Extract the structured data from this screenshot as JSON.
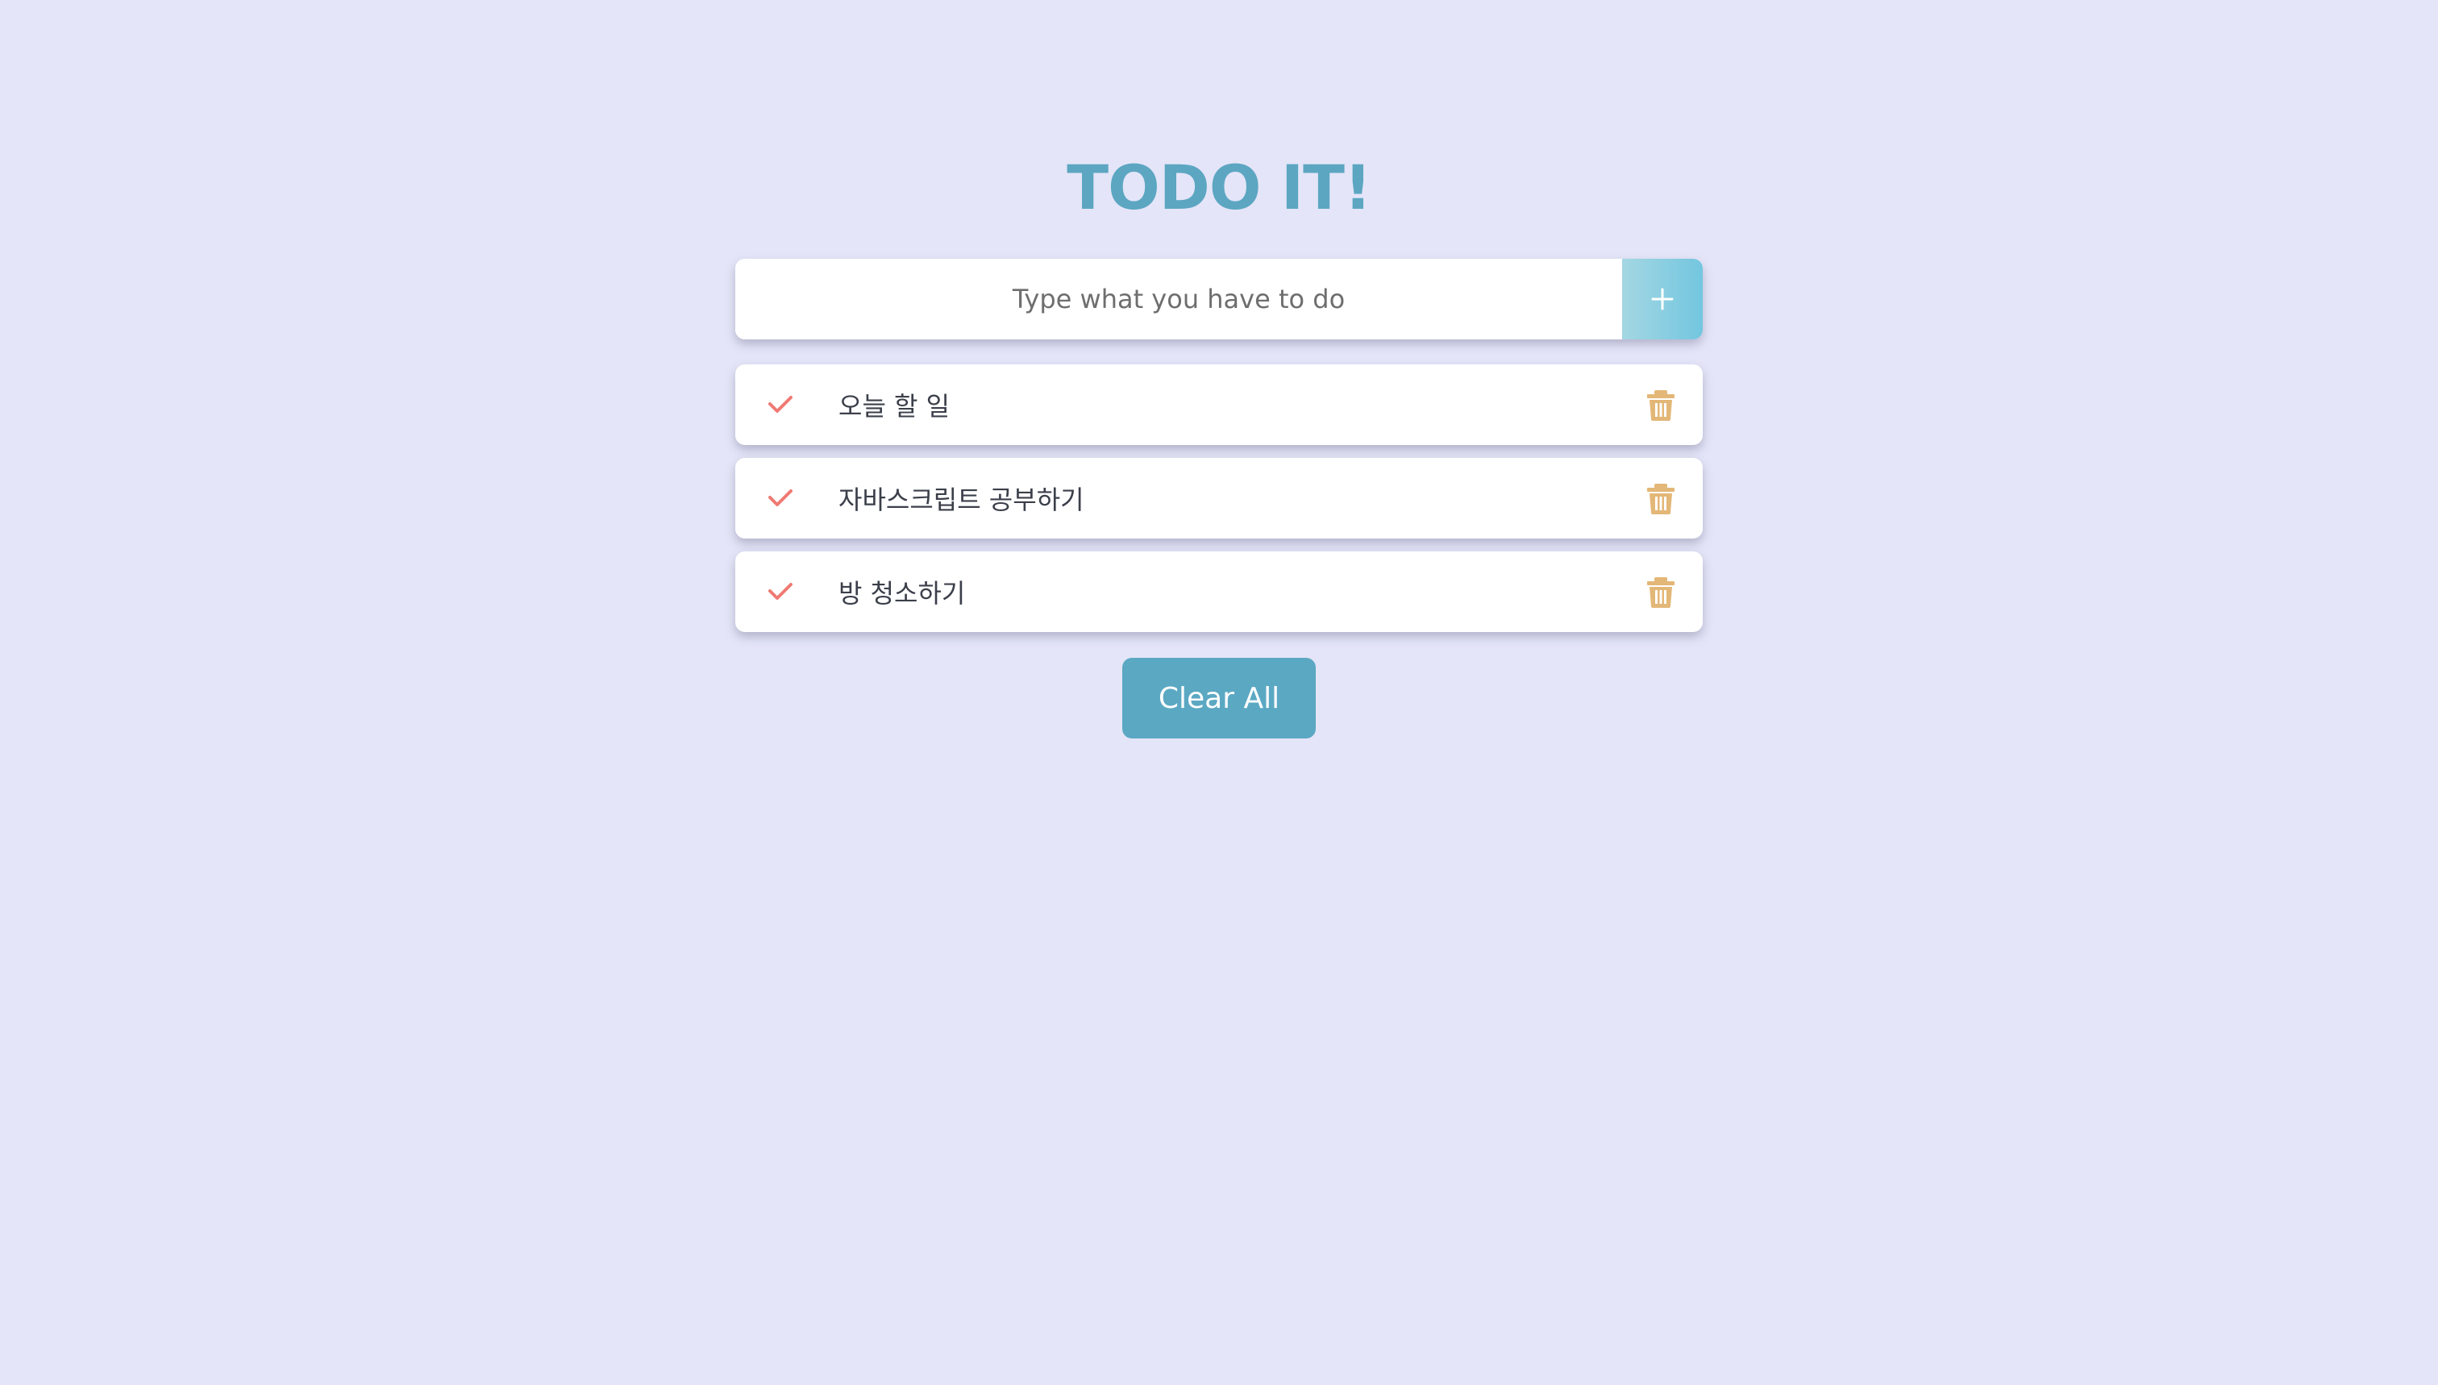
{
  "app": {
    "title": "TODO IT!"
  },
  "input": {
    "placeholder": "Type what you have to do",
    "value": "",
    "add_icon": "plus-icon"
  },
  "todos": [
    {
      "text": "오늘 할 일",
      "check_icon": "check-icon",
      "delete_icon": "trash-icon"
    },
    {
      "text": "자바스크립트 공부하기",
      "check_icon": "check-icon",
      "delete_icon": "trash-icon"
    },
    {
      "text": "방 청소하기",
      "check_icon": "check-icon",
      "delete_icon": "trash-icon"
    }
  ],
  "footer": {
    "clear_label": "Clear All"
  },
  "colors": {
    "background": "#e4e5f8",
    "title": "#5ca6c2",
    "check": "#f07a73",
    "trash": "#e3b777",
    "clear_button": "#5ba8c3",
    "add_button_start": "#a4d7e2",
    "add_button_end": "#73c6e0"
  }
}
